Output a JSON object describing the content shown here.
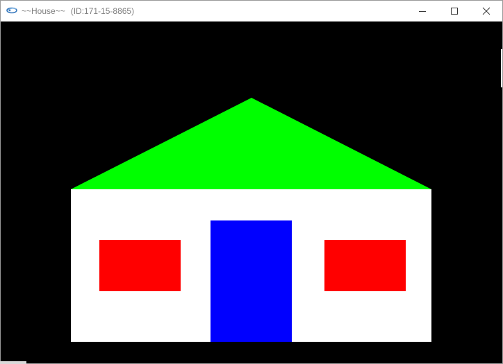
{
  "window": {
    "title": "~~House~~",
    "id_label": "(ID:171-15-8865)",
    "icons": {
      "app": "app-logo-icon",
      "minimize": "minimize-icon",
      "maximize": "maximize-icon",
      "close": "close-icon"
    }
  },
  "scene": {
    "background_color": "#000000",
    "roof_color": "#00ff00",
    "wall_color": "#ffffff",
    "door_color": "#0000ff",
    "window_color": "#ff0000"
  }
}
